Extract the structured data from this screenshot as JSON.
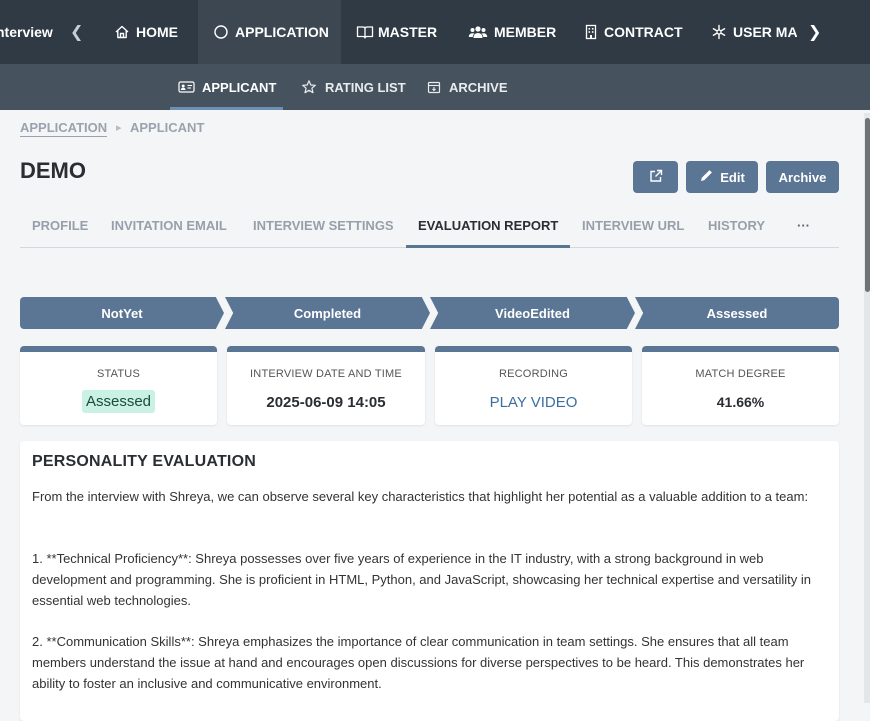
{
  "topnav": {
    "brand": "nterview",
    "items": [
      {
        "label": "HOME",
        "icon": "home-icon"
      },
      {
        "label": "APPLICATION",
        "icon": "circle-icon"
      },
      {
        "label": "MASTER",
        "icon": "book-icon"
      },
      {
        "label": "MEMBER",
        "icon": "users-icon"
      },
      {
        "label": "CONTRACT",
        "icon": "building-icon"
      },
      {
        "label": "USER MAN",
        "icon": "snowflake-icon"
      }
    ]
  },
  "subnav": {
    "items": [
      {
        "label": "APPLICANT",
        "icon": "id-card-icon"
      },
      {
        "label": "RATING LIST",
        "icon": "star-icon"
      },
      {
        "label": "ARCHIVE",
        "icon": "archive-box-icon"
      }
    ]
  },
  "breadcrumb": {
    "parent": "APPLICATION",
    "sep": "▸",
    "current": "APPLICANT"
  },
  "page": {
    "title": "DEMO"
  },
  "actions": {
    "edit_label": "Edit",
    "archive_label": "Archive"
  },
  "tabs": [
    "PROFILE",
    "INVITATION EMAIL",
    "INTERVIEW SETTINGS",
    "EVALUATION REPORT",
    "INTERVIEW URL",
    "HISTORY",
    "···"
  ],
  "steps": [
    "NotYet",
    "Completed",
    "VideoEdited",
    "Assessed"
  ],
  "cards": {
    "status": {
      "label": "STATUS",
      "value": "Assessed"
    },
    "datetime": {
      "label": "INTERVIEW DATE AND TIME",
      "value": "2025-06-09 14:05"
    },
    "recording": {
      "label": "RECORDING",
      "value": "PLAY VIDEO"
    },
    "match": {
      "label": "MATCH DEGREE",
      "value": "41.66%"
    }
  },
  "personality": {
    "title": "PERSONALITY EVALUATION",
    "p1": "From the interview with Shreya, we can observe several key characteristics that highlight her potential as a valuable addition to a team:",
    "p2": "1. **Technical Proficiency**: Shreya possesses over five years of experience in the IT industry, with a strong background in web development and programming. She is proficient in HTML, Python, and JavaScript, showcasing her technical expertise and versatility in essential web technologies.",
    "p3": "2. **Communication Skills**: Shreya emphasizes the importance of clear communication in team settings. She ensures that all team members understand the issue at hand and encourages open discussions for diverse perspectives to be heard. This demonstrates her ability to foster an inclusive and communicative environment."
  },
  "colors": {
    "nav_bg": "#2f3a45",
    "subnav_bg": "#46525e",
    "accent": "#5b7594",
    "badge_bg": "#c9f1e4",
    "link": "#3a6fa0"
  }
}
